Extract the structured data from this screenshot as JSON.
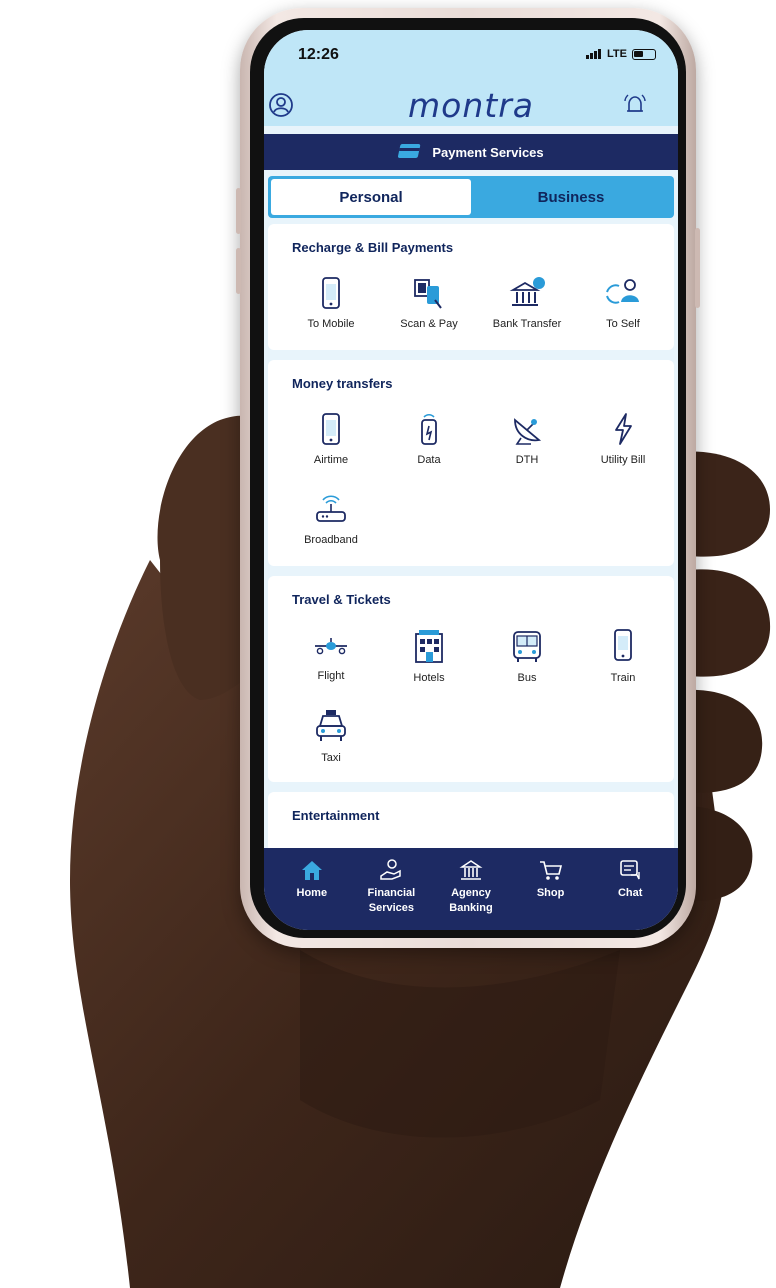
{
  "status_bar": {
    "time": "12:26",
    "network": "LTE"
  },
  "header": {
    "logo": "montra"
  },
  "payment_bar": {
    "label": "Payment Services"
  },
  "tabs": [
    {
      "label": "Personal",
      "active": true
    },
    {
      "label": "Business",
      "active": false
    }
  ],
  "sections": [
    {
      "title": "Recharge & Bill Payments",
      "items": [
        {
          "label": "To Mobile",
          "icon": "mobile-icon"
        },
        {
          "label": "Scan & Pay",
          "icon": "scan-pay-icon"
        },
        {
          "label": "Bank Transfer",
          "icon": "bank-icon"
        },
        {
          "label": "To Self",
          "icon": "to-self-icon"
        }
      ]
    },
    {
      "title": "Money transfers",
      "items": [
        {
          "label": "Airtime",
          "icon": "airtime-icon"
        },
        {
          "label": "Data",
          "icon": "data-icon"
        },
        {
          "label": "DTH",
          "icon": "satellite-dish-icon"
        },
        {
          "label": "Utility Bill",
          "icon": "lightning-icon"
        },
        {
          "label": "Broadband",
          "icon": "router-icon"
        }
      ]
    },
    {
      "title": "Travel & Tickets",
      "items": [
        {
          "label": "Flight",
          "icon": "flight-icon"
        },
        {
          "label": "Hotels",
          "icon": "hotel-icon"
        },
        {
          "label": "Bus",
          "icon": "bus-icon"
        },
        {
          "label": "Train",
          "icon": "train-icon"
        },
        {
          "label": "Taxi",
          "icon": "taxi-icon"
        }
      ]
    },
    {
      "title": "Entertainment",
      "items": []
    }
  ],
  "bottom_nav": [
    {
      "label": "Home",
      "icon": "home-icon"
    },
    {
      "label": "Financial Services",
      "icon": "financial-services-icon"
    },
    {
      "label": "Agency Banking",
      "icon": "agency-banking-icon"
    },
    {
      "label": "Shop",
      "icon": "cart-icon"
    },
    {
      "label": "Chat",
      "icon": "chat-icon"
    }
  ],
  "colors": {
    "navy": "#1d2a63",
    "accent_blue": "#3aa9e0",
    "header_bg": "#bfe6f7",
    "icon_blue": "#2a9bd8"
  }
}
